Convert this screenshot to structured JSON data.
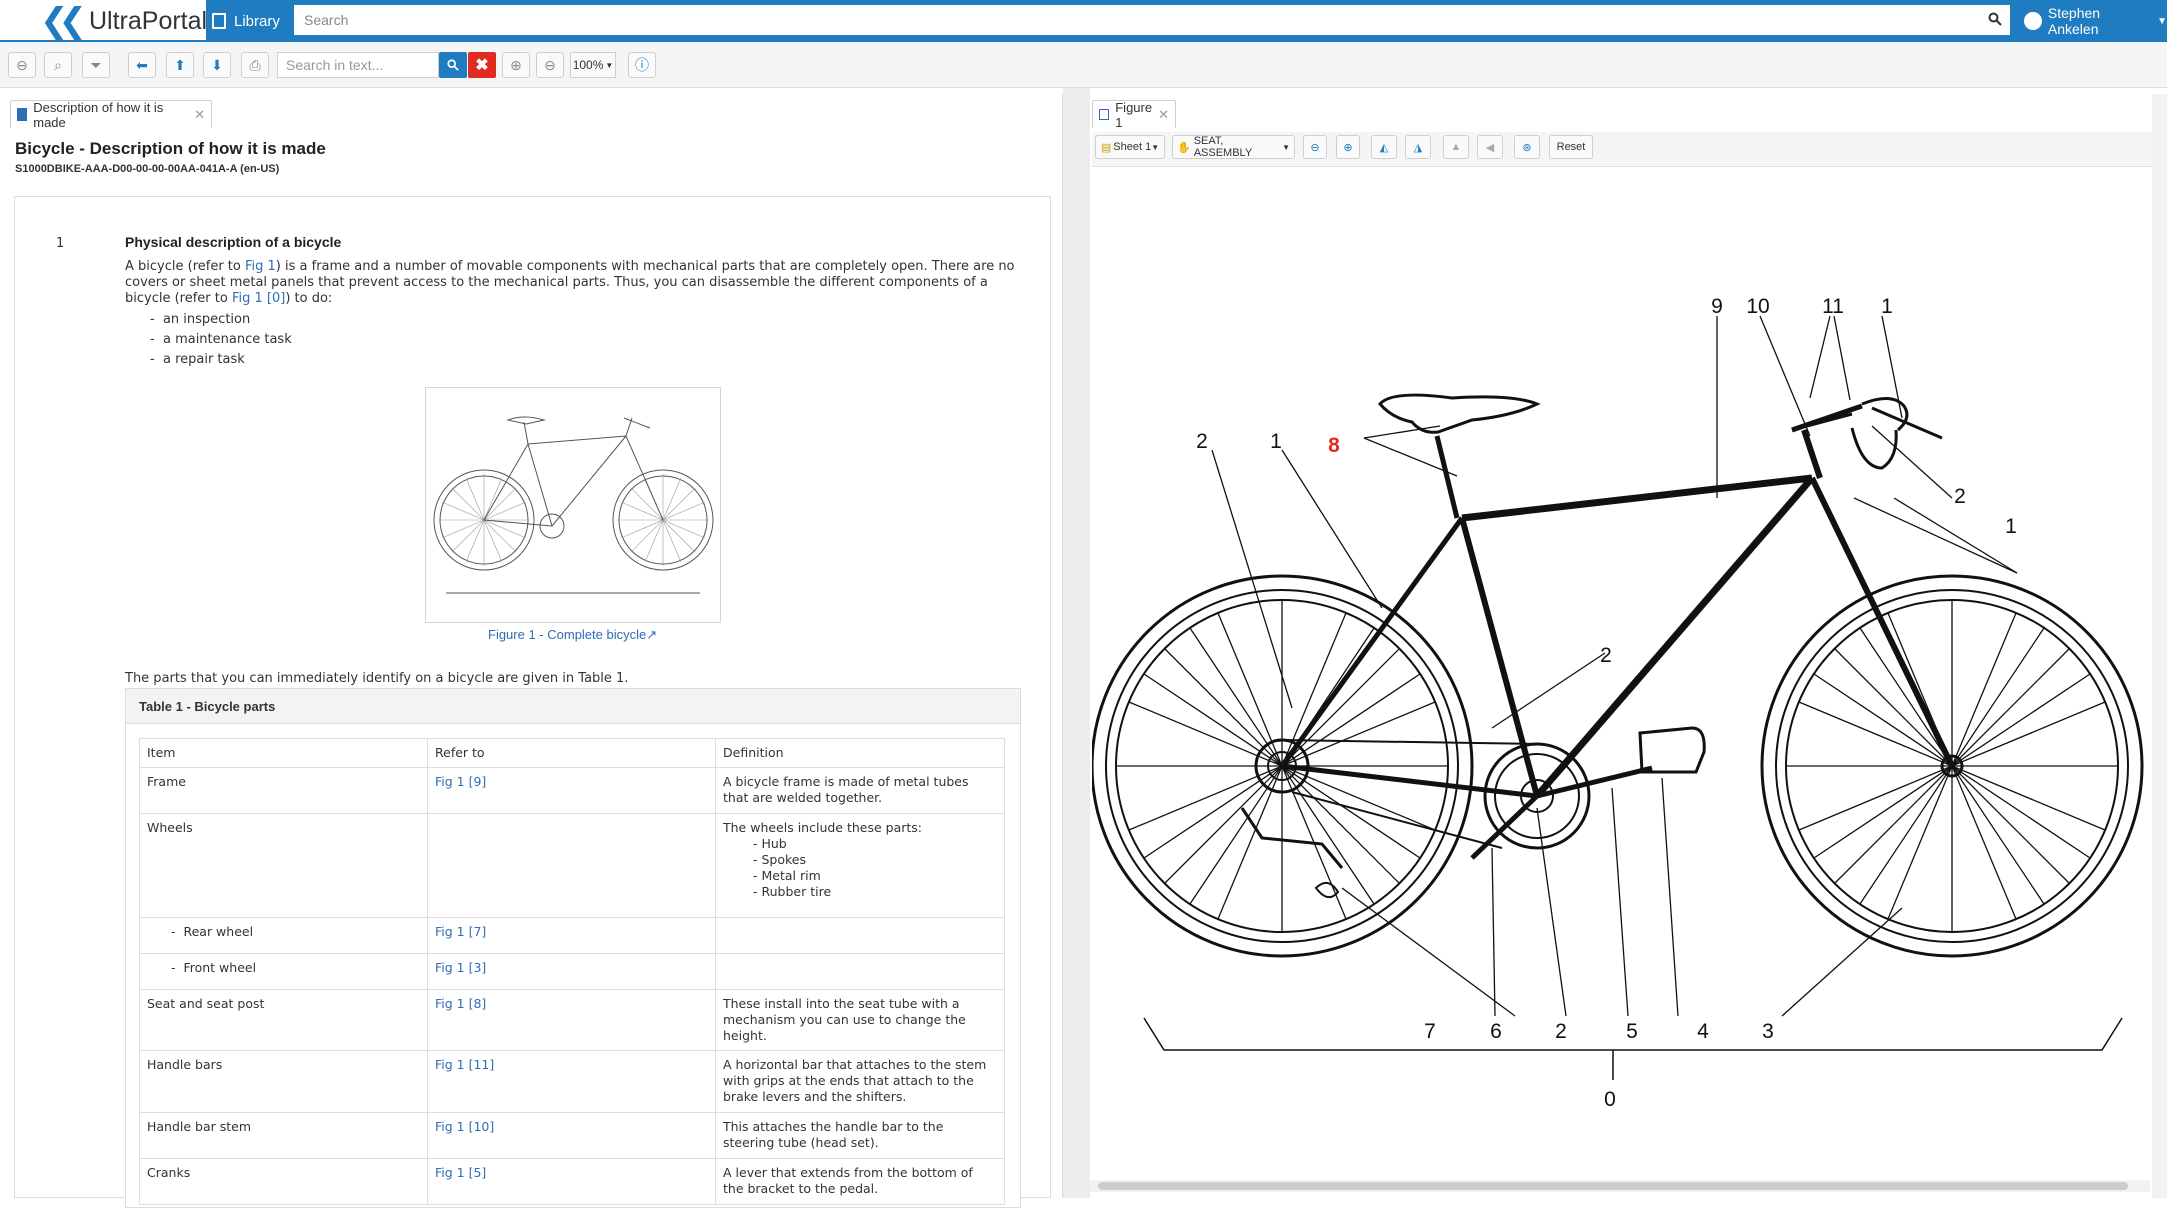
{
  "app": {
    "logo_text": "UltraPortal",
    "library_label": "Library",
    "search_placeholder": "Search",
    "user_name": "Stephen Ankelen"
  },
  "toolbar": {
    "find_placeholder": "Search in text...",
    "zoom": "100%"
  },
  "left_tab": {
    "label": "Description of how it is made"
  },
  "document": {
    "title": "Bicycle - Description of how it is made",
    "code": "S1000DBIKE-AAA-D00-00-00-00AA-041A-A (en-US)",
    "para_number": "1",
    "para_title": "Physical description of a bicycle",
    "para_text_1": "A bicycle (refer to ",
    "para_link_1": "Fig 1",
    "para_text_2": ") is a frame and a number of movable components with mechanical parts that are completely open. There are no covers or sheet metal panels that prevent access to the mechanical parts. Thus, you can disassemble the different components of a bicycle (refer to ",
    "para_link_2": "Fig 1 [0]",
    "para_text_3": ") to do:",
    "list": [
      "an inspection",
      "a maintenance task",
      "a repair task"
    ],
    "figure_caption": "Figure 1 - Complete bicycle",
    "table_intro": "The parts that you can immediately identify on a bicycle are given in Table 1.",
    "table_title": "Table 1 - Bicycle parts",
    "table_headers": [
      "Item",
      "Refer to",
      "Definition"
    ],
    "rows": [
      {
        "item": "Frame",
        "ref": "Fig 1 [9]",
        "def": "A bicycle frame is made of metal tubes that are welded together."
      },
      {
        "item": "Wheels",
        "ref": "",
        "def": "The wheels include these parts:",
        "sub": [
          "Hub",
          "Spokes",
          "Metal rim",
          "Rubber tire"
        ]
      },
      {
        "item": "Rear wheel",
        "ref": "Fig 1 [7]",
        "def": ""
      },
      {
        "item": "Front wheel",
        "ref": "Fig 1 [3]",
        "def": ""
      },
      {
        "item": "Seat and seat post",
        "ref": "Fig 1 [8]",
        "def": "These install into the seat tube with a mechanism you can use to change the height."
      },
      {
        "item": "Handle bars",
        "ref": "Fig 1 [11]",
        "def": "A horizontal bar that attaches to the stem with grips at the ends that attach to the brake levers and the shifters."
      },
      {
        "item": "Handle bar stem",
        "ref": "Fig 1 [10]",
        "def": "This attaches the handle bar to the steering tube (head set)."
      },
      {
        "item": "Cranks",
        "ref": "Fig 1 [5]",
        "def": "A lever that extends from the bottom of the bracket to the pedal."
      }
    ]
  },
  "right_tab": {
    "label": "Figure 1"
  },
  "figure_toolbar": {
    "sheet": "Sheet 1",
    "assembly": "SEAT, ASSEMBLY",
    "reset": "Reset"
  },
  "callouts": {
    "c9": "9",
    "c10": "10",
    "c11": "11",
    "c1a": "1",
    "c2a": "2",
    "c1b": "1",
    "c8": "8",
    "c2b": "2",
    "c1c": "1",
    "c2c": "2",
    "c7": "7",
    "c6": "6",
    "c2d": "2",
    "c5": "5",
    "c4": "4",
    "c3": "3",
    "c0": "0",
    "t9": "9",
    "t10": "10",
    "t11": "11",
    "t1": "1",
    "t2": "2",
    "t8": "8",
    "t0": "0",
    "t7": "7",
    "t6": "6",
    "t5": "5",
    "t4": "4",
    "t3": "3"
  },
  "colors": {
    "brand": "#1f7cc1",
    "link": "#2f6db5",
    "highlight": "#e02b20"
  }
}
